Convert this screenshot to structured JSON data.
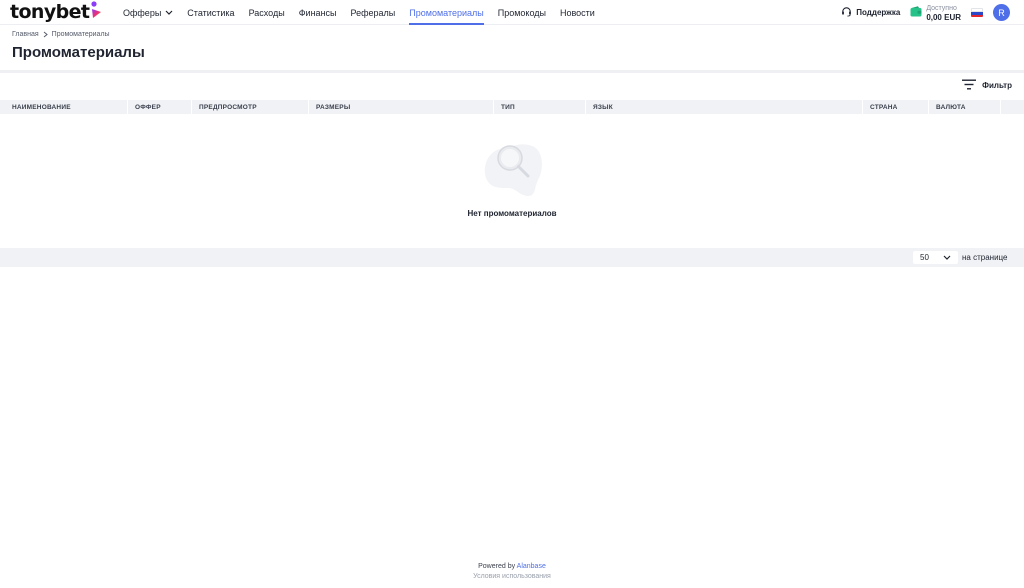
{
  "brand": {
    "name": "tonybet",
    "accent": "#4f6fe8"
  },
  "nav": {
    "items": [
      {
        "label": "Офферы",
        "has_dropdown": true
      },
      {
        "label": "Статистика"
      },
      {
        "label": "Расходы"
      },
      {
        "label": "Финансы"
      },
      {
        "label": "Рефералы"
      },
      {
        "label": "Промоматериалы",
        "active": true
      },
      {
        "label": "Промокоды"
      },
      {
        "label": "Новости"
      }
    ]
  },
  "header": {
    "support_label": "Поддержка",
    "balance_label": "Доступно",
    "balance_value": "0,00 EUR",
    "language_flag": "ru-flag-icon",
    "avatar_initial": "R"
  },
  "breadcrumb": {
    "home": "Главная",
    "current": "Промоматериалы"
  },
  "page": {
    "title": "Промоматериалы"
  },
  "toolbar": {
    "filter_label": "Фильтр"
  },
  "table": {
    "columns": [
      "НАИМЕНОВАНИЕ",
      "ОФФЕР",
      "ПРЕДПРОСМОТР",
      "РАЗМЕРЫ",
      "ТИП",
      "ЯЗЫК",
      "СТРАНА",
      "ВАЛЮТА"
    ],
    "rows": [],
    "empty_text": "Нет промоматериалов"
  },
  "pagination": {
    "per_page_value": "50",
    "per_page_label": "на странице"
  },
  "footer": {
    "powered_prefix": "Powered by",
    "powered_link": "Alanbase",
    "terms": "Условия использования"
  }
}
